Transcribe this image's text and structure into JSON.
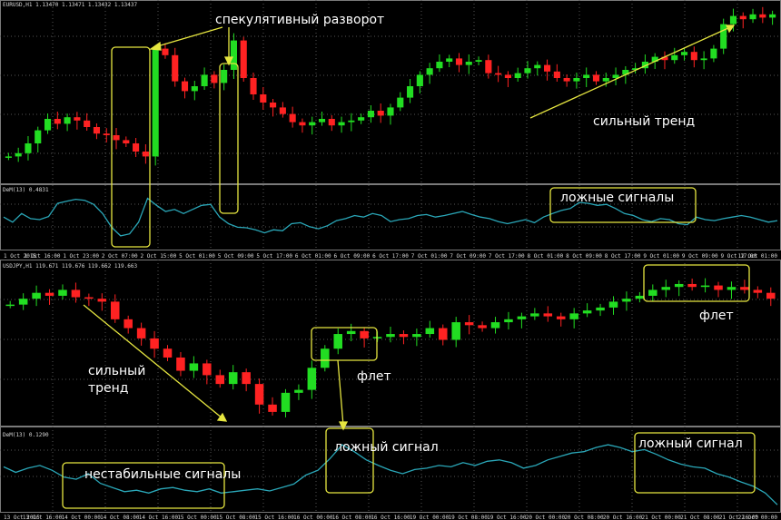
{
  "panels": [
    {
      "header": "EURUSD,H1  1.13470 1.13471 1.13432 1.13437"
    },
    {
      "header": "DeM(13) 0.4831"
    },
    {
      "header": "USDJPY,H1  119.671 119.676 119.662 119.663"
    },
    {
      "header": "DeM(13) 0.1290"
    }
  ],
  "time_axis_top": [
    "1 Oct 2015",
    "1 Oct 16:00",
    "1 Oct 23:00",
    "2 Oct 07:00",
    "2 Oct 15:00",
    "5 Oct 01:00",
    "5 Oct 09:00",
    "5 Oct 17:00",
    "6 Oct 01:00",
    "6 Oct 09:00",
    "6 Oct 17:00",
    "7 Oct 01:00",
    "7 Oct 09:00",
    "7 Oct 17:00",
    "8 Oct 01:00",
    "8 Oct 09:00",
    "8 Oct 17:00",
    "9 Oct 01:00",
    "9 Oct 09:00",
    "9 Oct 17:00",
    "12 Oct 01:00"
  ],
  "time_axis_bottom": [
    "13 Oct 2015",
    "13 Oct 16:00",
    "14 Oct 00:00",
    "14 Oct 08:00",
    "14 Oct 16:00",
    "15 Oct 00:00",
    "15 Oct 08:00",
    "15 Oct 16:00",
    "16 Oct 00:00",
    "16 Oct 08:00",
    "16 Oct 16:00",
    "19 Oct 00:00",
    "19 Oct 08:00",
    "19 Oct 16:00",
    "20 Oct 00:00",
    "20 Oct 08:00",
    "20 Oct 16:00",
    "21 Oct 00:00",
    "21 Oct 08:00",
    "21 Oct 16:00",
    "22 Oct 00:00"
  ],
  "annotations": {
    "spec_reversal": "спекулятивный разворот",
    "strong_trend_top": "сильный тренд",
    "false_signals": "ложные сигналы",
    "flat_right": "флет",
    "strong_trend_bottom_1": "сильный",
    "strong_trend_bottom_2": "тренд",
    "flat_mid": "флет",
    "false_signal_1": "ложный сигнал",
    "false_signal_2": "ложный сигнал",
    "unstable_signals": "нестабильные сигналы"
  },
  "colors": {
    "background": "#000000",
    "bull_candle": "#22dd22",
    "bear_candle": "#ff2222",
    "indicator_line": "#2aa7b8",
    "annotation_box": "#e6e640",
    "annotation_arrow": "#e6e640",
    "grid": "#555555"
  },
  "chart_data": [
    {
      "type": "candlestick",
      "symbol": "EURUSD,H1",
      "x_range": [
        "1 Oct 2015",
        "12 Oct 2015"
      ],
      "close_profile": [
        0.12,
        0.14,
        0.2,
        0.28,
        0.35,
        0.32,
        0.36,
        0.34,
        0.3,
        0.26,
        0.25,
        0.22,
        0.2,
        0.15,
        0.12,
        0.78,
        0.74,
        0.58,
        0.52,
        0.55,
        0.62,
        0.57,
        0.65,
        0.83,
        0.6,
        0.5,
        0.45,
        0.42,
        0.38,
        0.33,
        0.31,
        0.33,
        0.35,
        0.31,
        0.33,
        0.34,
        0.36,
        0.4,
        0.37,
        0.42,
        0.48,
        0.55,
        0.62,
        0.66,
        0.7,
        0.72,
        0.68,
        0.7,
        0.71,
        0.63,
        0.62,
        0.6,
        0.63,
        0.66,
        0.68,
        0.64,
        0.6,
        0.58,
        0.6,
        0.62,
        0.58,
        0.6,
        0.62,
        0.65,
        0.66,
        0.7,
        0.73,
        0.71,
        0.74,
        0.76,
        0.71,
        0.72,
        0.78,
        0.93,
        0.98,
        0.96,
        0.99,
        0.97,
        0.99
      ]
    },
    {
      "type": "line",
      "indicator": "DeM(13)",
      "value": 0.4831,
      "values": [
        0.55,
        0.45,
        0.62,
        0.52,
        0.5,
        0.56,
        0.82,
        0.86,
        0.9,
        0.88,
        0.8,
        0.62,
        0.35,
        0.18,
        0.22,
        0.45,
        0.92,
        0.78,
        0.66,
        0.7,
        0.62,
        0.7,
        0.78,
        0.8,
        0.55,
        0.42,
        0.35,
        0.34,
        0.3,
        0.24,
        0.3,
        0.28,
        0.42,
        0.44,
        0.36,
        0.32,
        0.38,
        0.48,
        0.52,
        0.58,
        0.55,
        0.62,
        0.58,
        0.46,
        0.5,
        0.52,
        0.58,
        0.6,
        0.55,
        0.58,
        0.62,
        0.66,
        0.6,
        0.55,
        0.52,
        0.46,
        0.42,
        0.46,
        0.5,
        0.44,
        0.55,
        0.62,
        0.68,
        0.72,
        0.84,
        0.82,
        0.78,
        0.8,
        0.72,
        0.62,
        0.58,
        0.5,
        0.46,
        0.52,
        0.5,
        0.42,
        0.4,
        0.55,
        0.5,
        0.48,
        0.52,
        0.55,
        0.58,
        0.55,
        0.5,
        0.45,
        0.48
      ]
    },
    {
      "type": "candlestick",
      "symbol": "USDJPY,H1",
      "x_range": [
        "13 Oct 2015",
        "22 Oct 2015"
      ],
      "close_profile": [
        0.78,
        0.82,
        0.86,
        0.84,
        0.88,
        0.83,
        0.82,
        0.8,
        0.68,
        0.62,
        0.55,
        0.48,
        0.42,
        0.33,
        0.38,
        0.3,
        0.24,
        0.32,
        0.24,
        0.1,
        0.05,
        0.18,
        0.2,
        0.35,
        0.48,
        0.58,
        0.6,
        0.55,
        0.56,
        0.58,
        0.56,
        0.58,
        0.62,
        0.54,
        0.66,
        0.64,
        0.62,
        0.66,
        0.68,
        0.7,
        0.72,
        0.7,
        0.68,
        0.72,
        0.74,
        0.76,
        0.8,
        0.82,
        0.84,
        0.88,
        0.9,
        0.92,
        0.9,
        0.91,
        0.88,
        0.9,
        0.88,
        0.86,
        0.82
      ]
    },
    {
      "type": "line",
      "indicator": "DeM(13)",
      "value": 0.129,
      "values": [
        0.6,
        0.52,
        0.58,
        0.62,
        0.55,
        0.45,
        0.42,
        0.5,
        0.36,
        0.3,
        0.24,
        0.26,
        0.22,
        0.28,
        0.3,
        0.26,
        0.24,
        0.28,
        0.22,
        0.24,
        0.26,
        0.28,
        0.25,
        0.3,
        0.35,
        0.48,
        0.55,
        0.72,
        0.92,
        0.82,
        0.7,
        0.62,
        0.55,
        0.5,
        0.56,
        0.58,
        0.62,
        0.6,
        0.66,
        0.62,
        0.68,
        0.7,
        0.66,
        0.58,
        0.62,
        0.7,
        0.75,
        0.8,
        0.82,
        0.88,
        0.92,
        0.88,
        0.82,
        0.85,
        0.78,
        0.7,
        0.64,
        0.6,
        0.58,
        0.5,
        0.45,
        0.38,
        0.32,
        0.22,
        0.05
      ]
    }
  ]
}
